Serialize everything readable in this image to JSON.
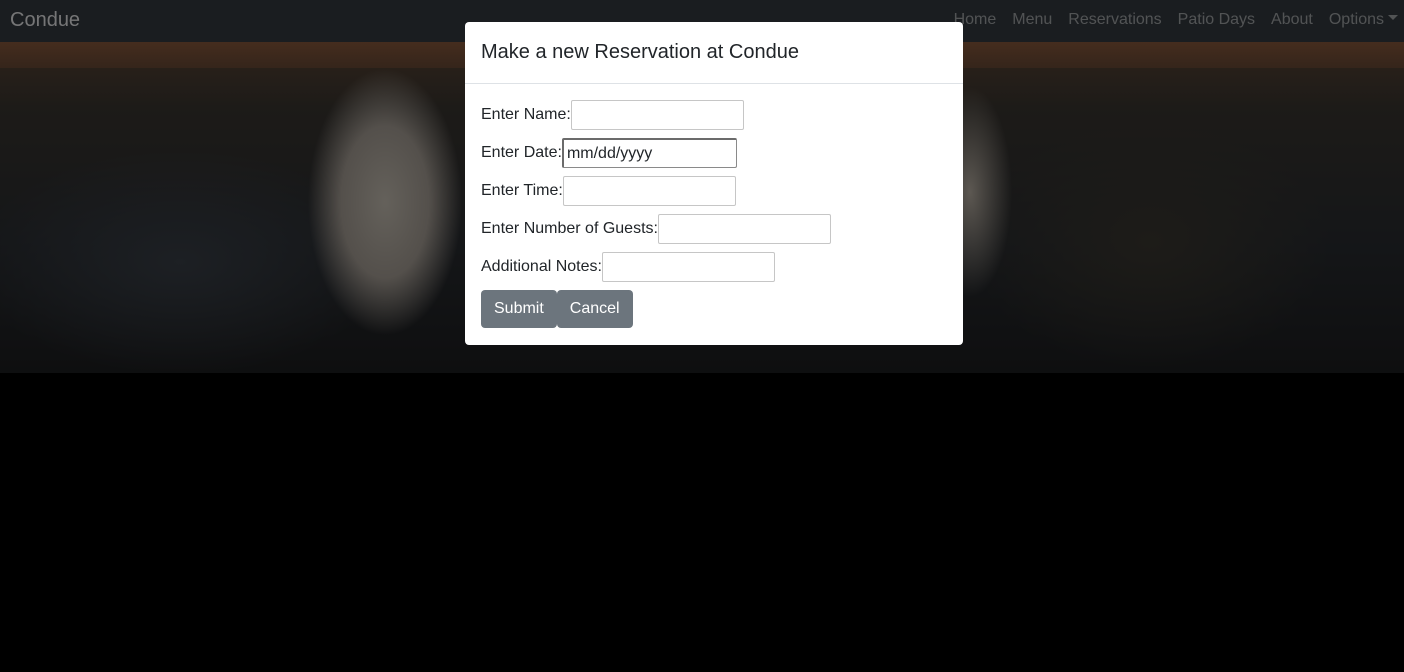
{
  "navbar": {
    "brand": "Condue",
    "links": [
      "Home",
      "Menu",
      "Reservations",
      "Patio Days",
      "About"
    ],
    "dropdown_label": "Options"
  },
  "modal": {
    "title": "Make a new Reservation at Condue",
    "fields": {
      "name_label": "Enter Name:",
      "date_label": "Enter Date:",
      "date_placeholder": "mm/dd/yyyy",
      "time_label": "Enter Time:",
      "guests_label": "Enter Number of Guests:",
      "notes_label": "Additional Notes:"
    },
    "submit_label": "Submit",
    "cancel_label": "Cancel"
  },
  "colors": {
    "navbar_bg": "#343a40",
    "button_bg": "#6c757d"
  }
}
